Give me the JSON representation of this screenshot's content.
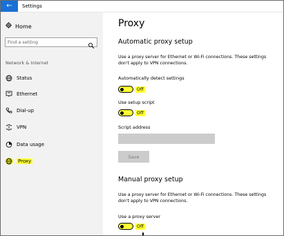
{
  "window": {
    "title": "Settings",
    "back_glyph": "←"
  },
  "sidebar": {
    "home_label": "Home",
    "search_placeholder": "Find a setting",
    "section_label": "Network & Internet",
    "items": [
      {
        "label": "Status",
        "icon": "globe-icon"
      },
      {
        "label": "Ethernet",
        "icon": "ethernet-icon"
      },
      {
        "label": "Dial-up",
        "icon": "phone-icon"
      },
      {
        "label": "VPN",
        "icon": "vpn-icon"
      },
      {
        "label": "Data usage",
        "icon": "data-usage-icon"
      },
      {
        "label": "Proxy",
        "icon": "globe-icon",
        "active": true
      }
    ]
  },
  "main": {
    "title": "Proxy",
    "automatic": {
      "heading": "Automatic proxy setup",
      "description": "Use a proxy server for Ethernet or Wi-Fi connections. These settings don't apply to VPN connections.",
      "auto_detect_label": "Automatically detect settings",
      "auto_detect_state": "Off",
      "setup_script_label": "Use setup script",
      "setup_script_state": "Off",
      "script_address_label": "Script address",
      "script_address_value": "",
      "save_label": "Save"
    },
    "manual": {
      "heading": "Manual proxy setup",
      "description": "Use a proxy server for Ethernet or Wi-Fi connections. These settings don't apply to VPN connections.",
      "use_proxy_label": "Use a proxy server",
      "use_proxy_state": "Off"
    }
  },
  "colors": {
    "accent": "#1a70d6",
    "highlight": "#ffff33",
    "sidebar_bg": "#f2f2f2",
    "disabled": "#cccccc"
  }
}
